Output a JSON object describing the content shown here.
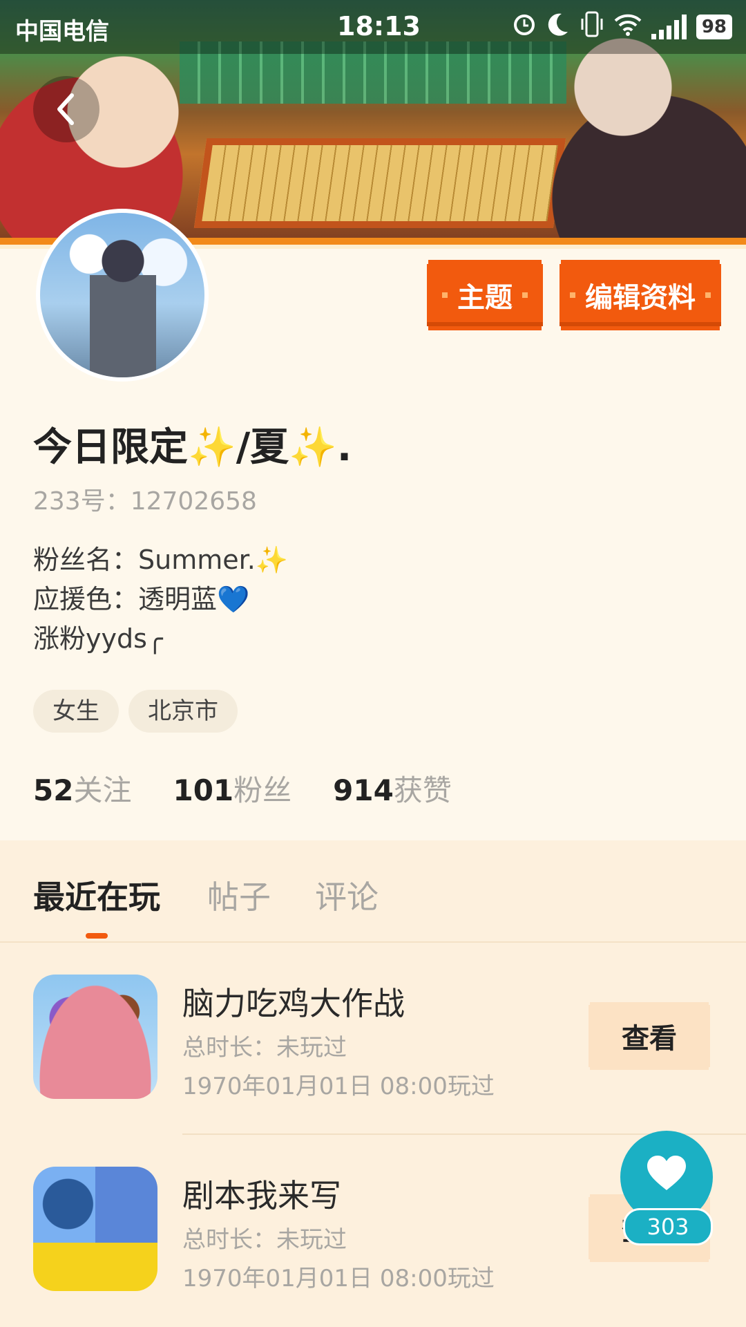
{
  "status_bar": {
    "carrier": "中国电信",
    "time": "18:13",
    "battery": "98",
    "icons": [
      "alarm-icon",
      "moon-icon",
      "vibrate-icon",
      "wifi-icon",
      "signal-icon",
      "battery-icon"
    ]
  },
  "header": {
    "back_icon": "chevron-left-icon",
    "theme_label": "主题",
    "edit_label": "编辑资料"
  },
  "profile": {
    "nickname": "今日限定✨/夏✨.",
    "uid": "233号：12702658",
    "bio": "粉丝名：Summer.✨\n应援色：透明蓝💙\n涨粉yyds╭",
    "tags": [
      "女生",
      "北京市"
    ],
    "stats": [
      {
        "value": "52",
        "label": "关注"
      },
      {
        "value": "101",
        "label": "粉丝"
      },
      {
        "value": "914",
        "label": "获赞"
      }
    ]
  },
  "tabs": [
    {
      "label": "最近在玩",
      "active": true
    },
    {
      "label": "帖子",
      "active": false
    },
    {
      "label": "评论",
      "active": false
    }
  ],
  "games": [
    {
      "title": "脑力吃鸡大作战",
      "duration": "总时长：未玩过",
      "last_played": "1970年01月01日 08:00玩过",
      "action": "查看"
    },
    {
      "title": "剧本我来写",
      "duration": "总时长：未玩过",
      "last_played": "1970年01月01日 08:00玩过",
      "action": "查看"
    }
  ],
  "like_fab": {
    "count": "303",
    "icon": "heart-icon"
  },
  "colors": {
    "accent": "#f25a0e",
    "background": "#fef8ec",
    "tab_bg": "#fdf0dd",
    "fab": "#1bb0c4"
  }
}
